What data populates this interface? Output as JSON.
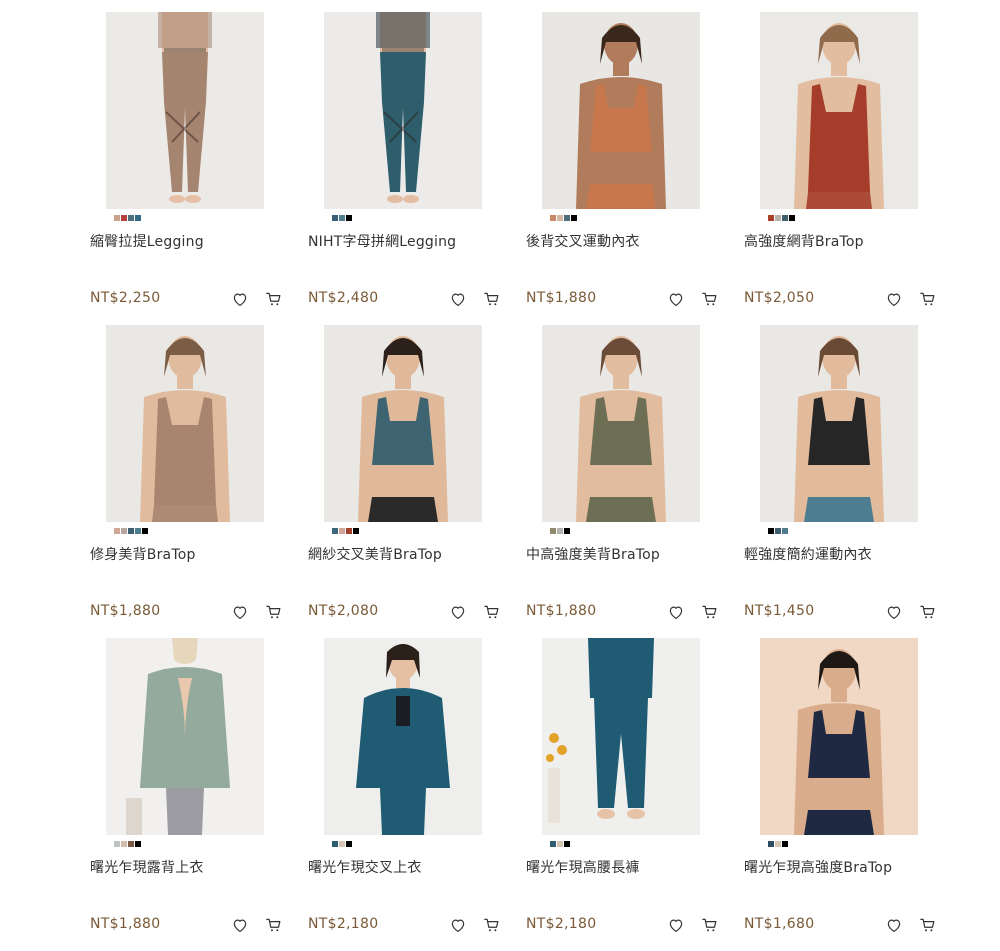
{
  "products": [
    {
      "name": "縮臀拉提Legging",
      "price": "NT$2,250",
      "type": "legging",
      "skin": "#e5c0a6",
      "hair": "#d6c8b8",
      "top": "#a58470",
      "bottom": "#a58470",
      "bg": "#eceae7",
      "swatches": [
        "#c9a18d",
        "#b5423a",
        "#4f6f7a",
        "#2f6a86"
      ],
      "wishlist_icon": "heart-icon",
      "cart_icon": "cart-icon"
    },
    {
      "name": "NIHT字母拼網Legging",
      "price": "NT$2,480",
      "type": "legging",
      "skin": "#e3bea3",
      "hair": "#e8e6e3",
      "top": "#23333d",
      "bottom": "#2e5d6b",
      "bg": "#ecebe9",
      "swatches": [
        "#3b5f78",
        "#4f7f91",
        "#000000"
      ],
      "wishlist_icon": "heart-icon",
      "cart_icon": "cart-icon"
    },
    {
      "name": "後背交叉運動內衣",
      "price": "NT$1,880",
      "type": "crop",
      "skin": "#b07c5c",
      "hair": "#3a281c",
      "top": "#c8774d",
      "bottom": "#c8774d",
      "bg": "#e9e7e4",
      "swatches": [
        "#c88966",
        "#d4b6a4",
        "#4f6a7b",
        "#000000"
      ],
      "wishlist_icon": "heart-icon",
      "cart_icon": "cart-icon"
    },
    {
      "name": "高強度網背BraTop",
      "price": "NT$2,050",
      "type": "tank",
      "skin": "#e2bd9f",
      "hair": "#8f6b4c",
      "top": "#a53d2a",
      "bottom": "#a53d2a",
      "bg": "#ebe9e6",
      "swatches": [
        "#a9402c",
        "#b8b2a9",
        "#3f5f6a",
        "#000000"
      ],
      "wishlist_icon": "heart-icon",
      "cart_icon": "cart-icon"
    },
    {
      "name": "修身美背BraTop",
      "price": "NT$1,880",
      "type": "tank",
      "skin": "#e1bb9d",
      "hair": "#7b5c45",
      "top": "#a98570",
      "bottom": "#a98570",
      "bg": "#eae8e5",
      "swatches": [
        "#cfa995",
        "#b7a7a1",
        "#3d5f71",
        "#4c7d8b",
        "#000000"
      ],
      "wishlist_icon": "heart-icon",
      "cart_icon": "cart-icon"
    },
    {
      "name": "網紗交叉美背BraTop",
      "price": "NT$2,080",
      "type": "crop",
      "skin": "#e0b99a",
      "hair": "#2c211a",
      "top": "#3f6471",
      "bottom": "#2a2a2a",
      "bg": "#eae8e5",
      "swatches": [
        "#3d657c",
        "#d1a79b",
        "#a3402c",
        "#000000"
      ],
      "wishlist_icon": "heart-icon",
      "cart_icon": "cart-icon"
    },
    {
      "name": "中高強度美背BraTop",
      "price": "NT$1,880",
      "type": "crop",
      "skin": "#e2bc9f",
      "hair": "#6b4c38",
      "top": "#6c6f53",
      "bottom": "#6c6f53",
      "bg": "#eae8e5",
      "swatches": [
        "#8f8a6d",
        "#b5b2b0",
        "#000000"
      ],
      "wishlist_icon": "heart-icon",
      "cart_icon": "cart-icon"
    },
    {
      "name": "輕強度簡約運動內衣",
      "price": "NT$1,450",
      "type": "crop",
      "skin": "#e1bb9c",
      "hair": "#6a4a35",
      "top": "#262626",
      "bottom": "#4d7d91",
      "bg": "#eae8e5",
      "swatches": [
        "#000000",
        "#3e5f6f",
        "#4f7d8f"
      ],
      "wishlist_icon": "heart-icon",
      "cart_icon": "cart-icon"
    },
    {
      "name": "曙光乍現露背上衣",
      "price": "NT$1,880",
      "type": "back",
      "skin": "#e9c8ad",
      "hair": "#e6d6bc",
      "top": "#93aa9c",
      "bottom": "#9d9ca3",
      "bg": "#f1f0ee",
      "swatches": [
        "#bfc4c2",
        "#d4bfae",
        "#7a5a44",
        "#000000"
      ],
      "wishlist_icon": "heart-icon",
      "cart_icon": "cart-icon"
    },
    {
      "name": "曙光乍現交叉上衣",
      "price": "NT$2,180",
      "type": "jacket",
      "skin": "#e4bfa2",
      "hair": "#2b201a",
      "top": "#1f5c73",
      "bottom": "#1f5c73",
      "bg": "#eeeeec",
      "swatches": [
        "#2e5e73",
        "#d4c5b5",
        "#000000"
      ],
      "wishlist_icon": "heart-icon",
      "cart_icon": "cart-icon"
    },
    {
      "name": "曙光乍現高腰長褲",
      "price": "NT$2,180",
      "type": "pants",
      "skin": "#e6c3a7",
      "hair": "#2b201a",
      "top": "#1f5c73",
      "bottom": "#1f5c73",
      "bg": "#efefee",
      "swatches": [
        "#2e5e73",
        "#d4c5b5",
        "#000000"
      ],
      "wishlist_icon": "heart-icon",
      "cart_icon": "cart-icon"
    },
    {
      "name": "曙光乍現高強度BraTop",
      "price": "NT$1,680",
      "type": "crop",
      "skin": "#d9ac8b",
      "hair": "#1f1915",
      "top": "#1f2942",
      "bottom": "#1f2942",
      "bg": "#f0d8c4",
      "swatches": [
        "#2e4d63",
        "#d4c5b5",
        "#000000"
      ],
      "wishlist_icon": "heart-icon",
      "cart_icon": "cart-icon"
    }
  ]
}
